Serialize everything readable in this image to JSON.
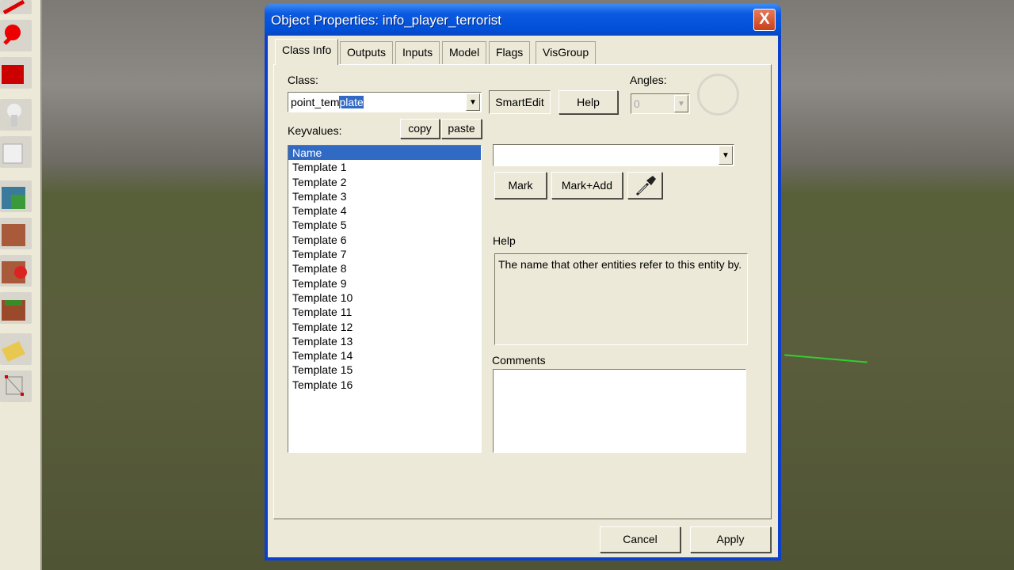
{
  "dialog": {
    "title": "Object Properties: info_player_terrorist",
    "close": "X"
  },
  "tabs": [
    "Class Info",
    "Outputs",
    "Inputs",
    "Model",
    "Flags",
    "VisGroup"
  ],
  "class_label": "Class:",
  "class_value_plain": "point_tem",
  "class_value_selected": "plate",
  "smartedit": "SmartEdit",
  "help_button": "Help",
  "angles_label": "Angles:",
  "angles_value": "0",
  "keyvalues_label": "Keyvalues:",
  "copy": "copy",
  "paste": "paste",
  "keyvalues": [
    "Name",
    "Template 1",
    "Template 2",
    "Template 3",
    "Template 4",
    "Template 5",
    "Template 6",
    "Template 7",
    "Template 8",
    "Template 9",
    "Template 10",
    "Template 11",
    "Template 12",
    "Template 13",
    "Template 14",
    "Template 15",
    "Template 16"
  ],
  "mark": "Mark",
  "mark_add": "Mark+Add",
  "help_label": "Help",
  "help_text": "The name that other entities refer to this entity by.",
  "comments_label": "Comments",
  "cancel": "Cancel",
  "apply": "Apply",
  "colors": {
    "titlebar": "#0050d8",
    "face": "#ece9d8",
    "selection": "#316ac5"
  }
}
